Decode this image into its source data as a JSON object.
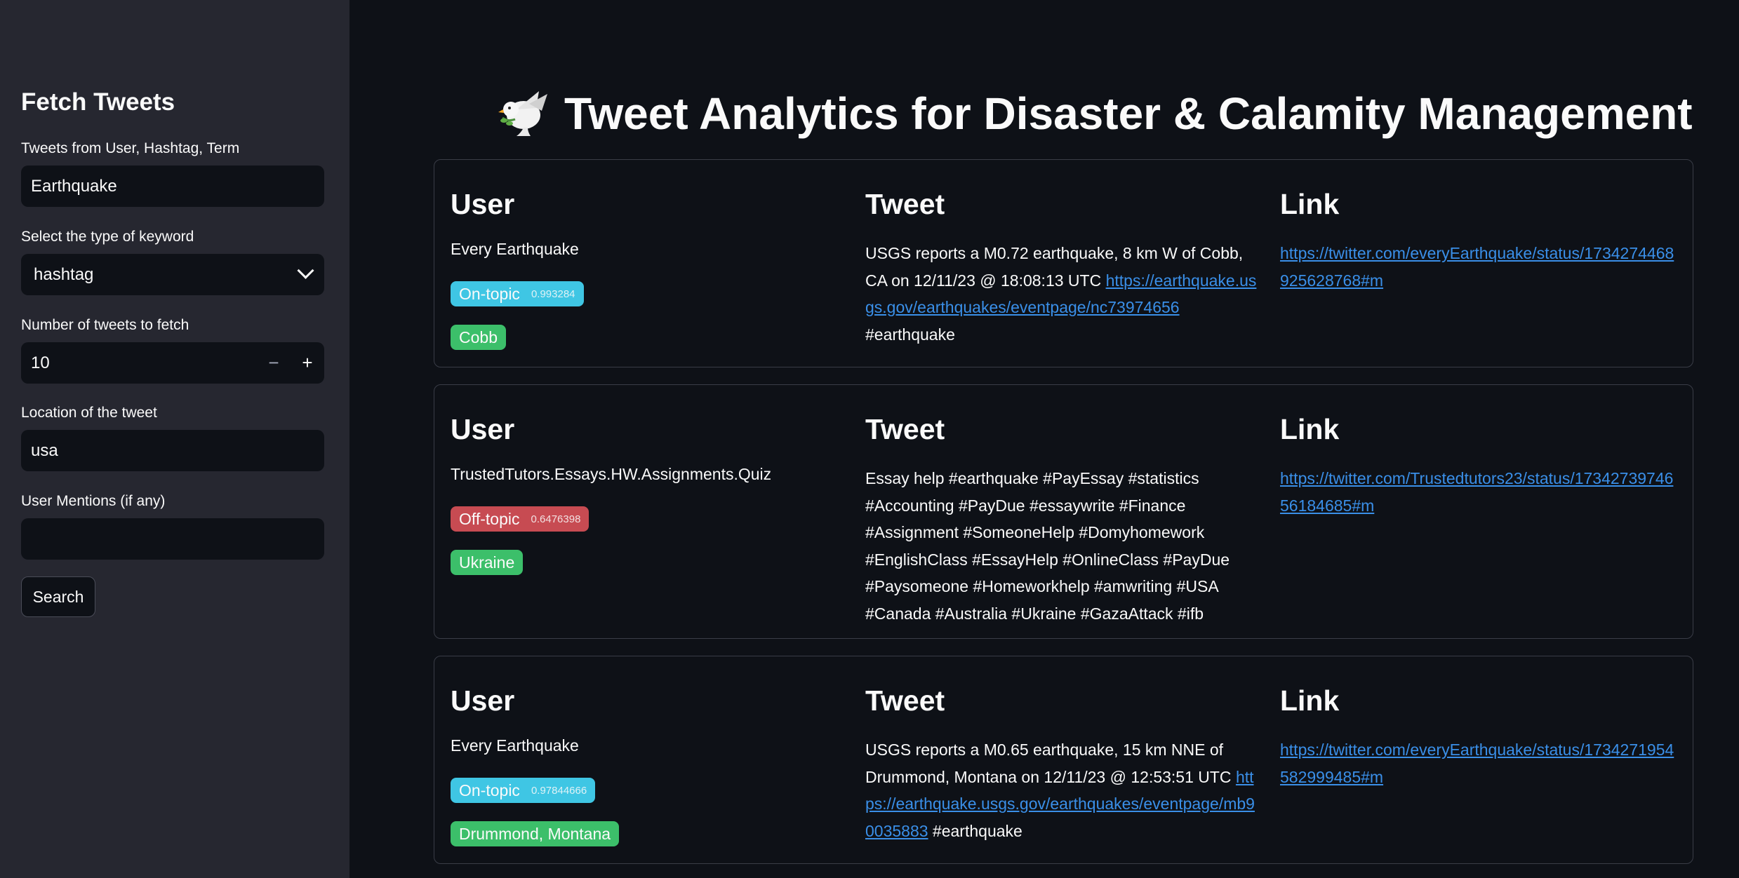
{
  "sidebar": {
    "heading": "Fetch Tweets",
    "query_label": "Tweets from User, Hashtag, Term",
    "query_value": "Earthquake",
    "keyword_type_label": "Select the type of keyword",
    "keyword_type_value": "hashtag",
    "count_label": "Number of tweets to fetch",
    "count_value": "10",
    "minus": "−",
    "plus": "+",
    "location_label": "Location of the tweet",
    "location_value": "usa",
    "mentions_label": "User Mentions (if any)",
    "mentions_value": "",
    "search_button": "Search"
  },
  "main": {
    "title": "Tweet Analytics for Disaster & Calamity Management",
    "col_user": "User",
    "col_tweet": "Tweet",
    "col_link": "Link",
    "tweets": [
      {
        "user": "Every Earthquake",
        "topic": "On-topic",
        "score": "0.993284",
        "location": "Cobb",
        "text_before": "USGS reports a M0.72 earthquake, 8 km W of Cobb, CA on 12/11/23 @ 18:08:13 UTC ",
        "text_link": "https://earthquake.usgs.gov/earthquakes/eventpage/nc73974656",
        "text_after": " #earthquake",
        "link": "https://twitter.com/everyEarthquake/status/1734274468925628768#m"
      },
      {
        "user": "TrustedTutors.Essays.HW.Assignments.Quiz",
        "topic": "Off-topic",
        "score": "0.6476398",
        "location": "Ukraine",
        "text_before": "Essay help #earthquake #PayEssay #statistics #Accounting #PayDue #essaywrite #Finance #Assignment #SomeoneHelp #Domyhomework #EnglishClass #EssayHelp #OnlineClass #PayDue #Paysomeone #Homeworkhelp #amwriting #USA #Canada #Australia #Ukraine #GazaAttack #ifb",
        "text_link": "",
        "text_after": "",
        "link": "https://twitter.com/Trustedtutors23/status/1734273974656184685#m"
      },
      {
        "user": "Every Earthquake",
        "topic": "On-topic",
        "score": "0.97844666",
        "location": "Drummond, Montana",
        "text_before": "USGS reports a M0.65 earthquake, 15 km NNE of Drummond, Montana on 12/11/23 @ 12:53:51 UTC ",
        "text_link": "https://earthquake.usgs.gov/earthquakes/eventpage/mb90035883",
        "text_after": " #earthquake",
        "link": "https://twitter.com/everyEarthquake/status/1734271954582999485#m"
      }
    ]
  }
}
